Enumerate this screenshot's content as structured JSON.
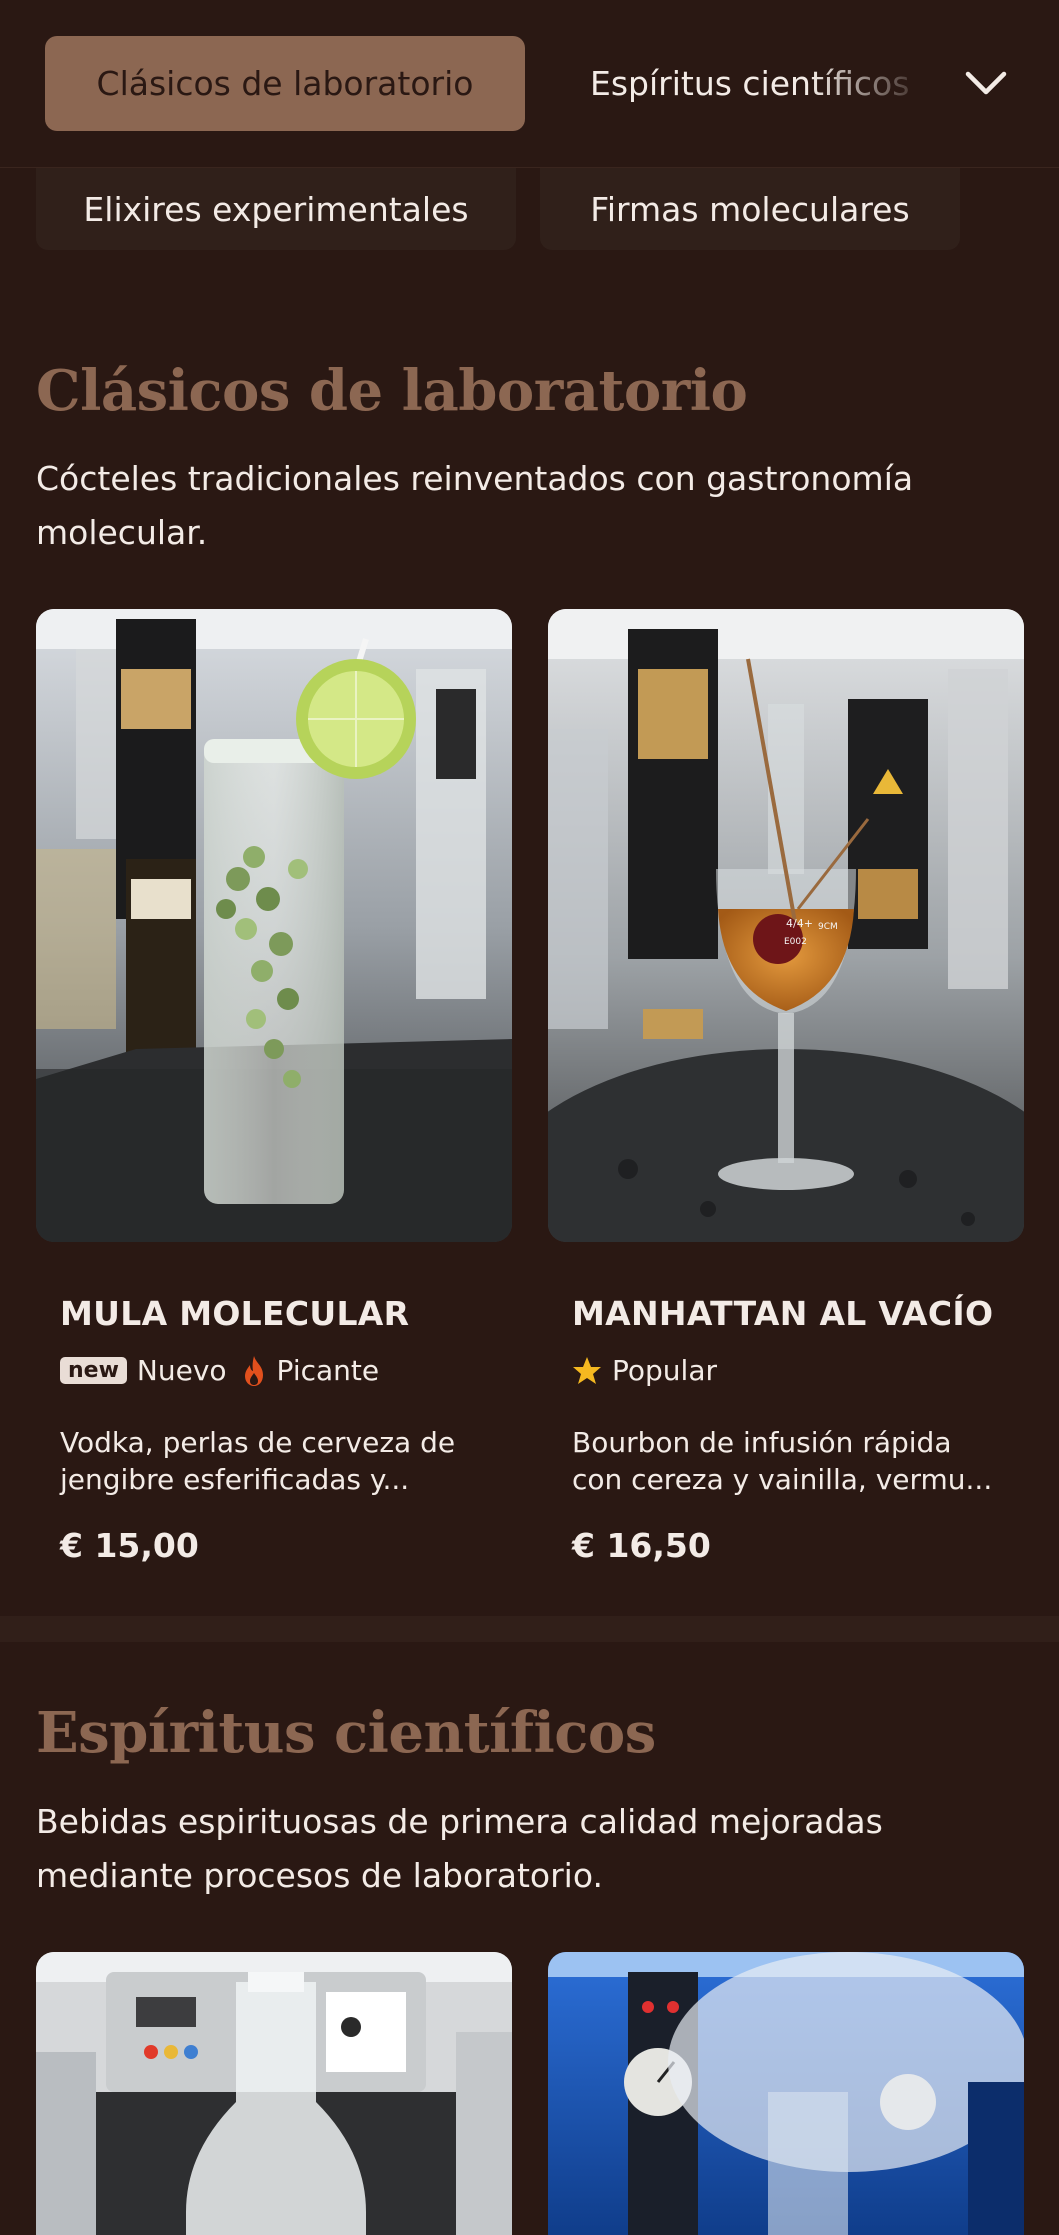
{
  "tabs": {
    "active": "Clásicos de laboratorio",
    "next": "Espíritus científicos",
    "row2": [
      "Elixires experimentales",
      "Firmas moleculares"
    ]
  },
  "sections": [
    {
      "title": "Clásicos de laboratorio",
      "description": "Cócteles tradicionales reinventados con gastronomía molecular.",
      "items": [
        {
          "name": "MULA MOLECULAR",
          "badge": "new",
          "tags": [
            "Nuevo",
            "Picante"
          ],
          "description_line1": "Vodka, perlas de cerveza de",
          "description_line2": "jengibre esferificadas y...",
          "price": "€ 15,00"
        },
        {
          "name": "MANHATTAN AL VACÍO",
          "tags": [
            "Popular"
          ],
          "description_line1": "Bourbon de infusión rápida",
          "description_line2": "con cereza y vainilla, vermu...",
          "price": "€ 16,50",
          "glass_label_1": "4/4+",
          "glass_label_2": "9CM",
          "glass_label_3": "E002"
        }
      ]
    },
    {
      "title": "Espíritus científicos",
      "description": "Bebidas espirituosas de primera calidad mejoradas mediante procesos de laboratorio."
    }
  ],
  "colors": {
    "background": "#2a1813",
    "accent": "#8c6752",
    "text": "#f3ebe6"
  },
  "icons": [
    "chevron-down-icon",
    "fire-icon",
    "star-icon"
  ]
}
